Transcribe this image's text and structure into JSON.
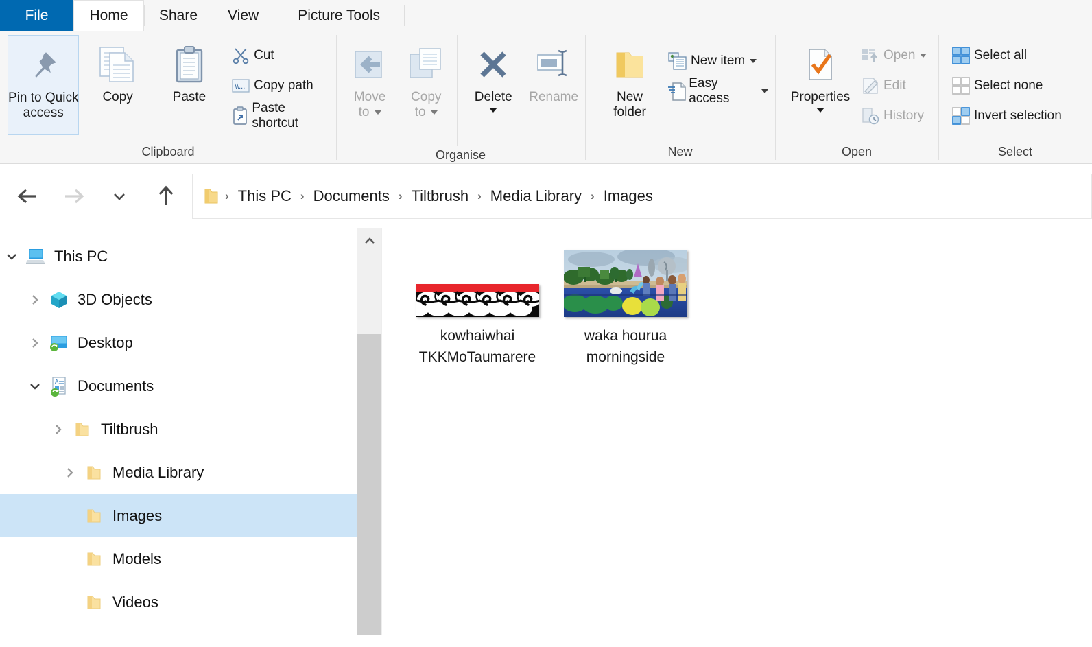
{
  "window": {
    "tabs": [
      {
        "label": "File",
        "active": false,
        "kind": "file"
      },
      {
        "label": "Home",
        "active": true,
        "kind": "normal"
      },
      {
        "label": "Share",
        "active": false,
        "kind": "normal"
      },
      {
        "label": "View",
        "active": false,
        "kind": "normal"
      },
      {
        "label": "Picture Tools",
        "active": false,
        "kind": "contextual"
      }
    ]
  },
  "ribbon": {
    "groups": [
      {
        "label": "Clipboard",
        "big_buttons": [
          {
            "label_line1": "Pin to Quick",
            "label_line2": "access",
            "icon": "pin-icon",
            "pinned": true,
            "disabled": false
          },
          {
            "label_line1": "Copy",
            "label_line2": "",
            "icon": "copy-icon",
            "pinned": false,
            "disabled": false
          },
          {
            "label_line1": "Paste",
            "label_line2": "",
            "icon": "paste-icon",
            "pinned": false,
            "disabled": false
          }
        ],
        "small_buttons": [
          {
            "label": "Cut",
            "icon": "scissors-icon",
            "disabled": false,
            "caret": false
          },
          {
            "label": "Copy path",
            "icon": "copy-path-icon",
            "disabled": false,
            "caret": false
          },
          {
            "label": "Paste shortcut",
            "icon": "paste-shortcut-icon",
            "disabled": false,
            "caret": false
          }
        ]
      },
      {
        "label": "Organise",
        "big_buttons": [
          {
            "label_line1": "Move",
            "label_line2": "to",
            "icon": "move-to-icon",
            "disabled": true,
            "caret": true
          },
          {
            "label_line1": "Copy",
            "label_line2": "to",
            "icon": "copy-to-icon",
            "disabled": true,
            "caret": true
          },
          {
            "label_line1": "Delete",
            "label_line2": "",
            "icon": "delete-icon",
            "disabled": false,
            "caret": true
          },
          {
            "label_line1": "Rename",
            "label_line2": "",
            "icon": "rename-icon",
            "disabled": true,
            "caret": false
          }
        ]
      },
      {
        "label": "New",
        "big_buttons": [
          {
            "label_line1": "New",
            "label_line2": "folder",
            "icon": "new-folder-icon",
            "disabled": false
          }
        ],
        "small_buttons": [
          {
            "label": "New item",
            "icon": "new-item-icon",
            "disabled": false,
            "caret": true
          },
          {
            "label": "Easy access",
            "icon": "easy-access-icon",
            "disabled": false,
            "caret": true
          }
        ]
      },
      {
        "label": "Open",
        "big_buttons": [
          {
            "label_line1": "Properties",
            "label_line2": "",
            "icon": "properties-icon",
            "disabled": false,
            "caret": true
          }
        ],
        "small_buttons": [
          {
            "label": "Open",
            "icon": "open-icon",
            "disabled": true,
            "caret": true
          },
          {
            "label": "Edit",
            "icon": "edit-icon",
            "disabled": true,
            "caret": false
          },
          {
            "label": "History",
            "icon": "history-icon",
            "disabled": true,
            "caret": false
          }
        ]
      },
      {
        "label": "Select",
        "small_buttons": [
          {
            "label": "Select all",
            "icon": "select-all-icon",
            "disabled": false,
            "caret": false
          },
          {
            "label": "Select none",
            "icon": "select-none-icon",
            "disabled": false,
            "caret": false
          },
          {
            "label": "Invert selection",
            "icon": "invert-selection-icon",
            "disabled": false,
            "caret": false
          }
        ]
      }
    ]
  },
  "address_bar": {
    "back": {
      "icon": "back-arrow-icon",
      "disabled": false
    },
    "forward": {
      "icon": "forward-arrow-icon",
      "disabled": true
    },
    "recent": {
      "icon": "chevron-down-icon",
      "disabled": false
    },
    "up": {
      "icon": "up-arrow-icon",
      "disabled": false
    },
    "folder_icon": "folder-icon",
    "separator": "›",
    "breadcrumbs": [
      "This PC",
      "Documents",
      "Tiltbrush",
      "Media Library",
      "Images"
    ]
  },
  "nav_pane": {
    "items": [
      {
        "label": "This PC",
        "indent": 0,
        "chevron": "expanded",
        "icon": "this-pc-icon",
        "selected": false
      },
      {
        "label": "3D Objects",
        "indent": 1,
        "chevron": "collapsed",
        "icon": "3d-objects-icon",
        "selected": false
      },
      {
        "label": "Desktop",
        "indent": 1,
        "chevron": "collapsed",
        "icon": "desktop-icon",
        "selected": false
      },
      {
        "label": "Documents",
        "indent": 1,
        "chevron": "expanded",
        "icon": "documents-icon",
        "selected": false
      },
      {
        "label": "Tiltbrush",
        "indent": 2,
        "chevron": "collapsed",
        "icon": "folder-icon",
        "selected": false
      },
      {
        "label": "Media Library",
        "indent": 3,
        "chevron": "collapsed",
        "icon": "folder-icon",
        "selected": false
      },
      {
        "label": "Images",
        "indent": 4,
        "chevron": "none",
        "icon": "folder-icon",
        "selected": true
      },
      {
        "label": "Models",
        "indent": 4,
        "chevron": "none",
        "icon": "folder-icon",
        "selected": false
      },
      {
        "label": "Videos",
        "indent": 4,
        "chevron": "none",
        "icon": "folder-icon",
        "selected": false
      }
    ],
    "scrollbar": {
      "up_icon": "scroll-up-icon"
    }
  },
  "file_list": {
    "view": "large-icons",
    "items": [
      {
        "name": "kowhaiwhai TKKMoTaumarere",
        "thumbnail": "kowhaiwhai-pattern-thumbnail",
        "selected": false
      },
      {
        "name": "waka hourua morningside",
        "thumbnail": "waka-hourua-scene-thumbnail",
        "selected": false
      }
    ]
  },
  "colors": {
    "file_tab_blue": "#0069b1",
    "selection_blue": "#cce4f7",
    "accent_orange": "#e8761b",
    "folder_yellow": "#ffd464",
    "disabled_grey": "#a6a6a6"
  }
}
